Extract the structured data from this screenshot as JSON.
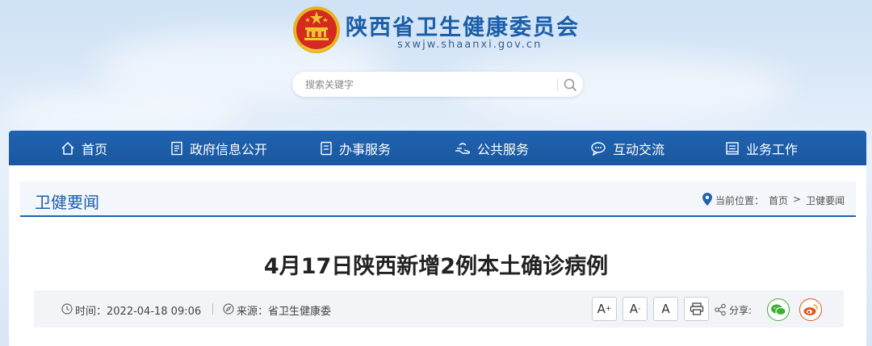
{
  "header": {
    "site_title": "陕西省卫生健康委员会",
    "site_domain": "sxwjw.shaanxi.gov.cn",
    "search_placeholder": "搜索关键字"
  },
  "nav": {
    "items": [
      {
        "label": "首页",
        "icon": "home-icon"
      },
      {
        "label": "政府信息公开",
        "icon": "document-icon"
      },
      {
        "label": "办事服务",
        "icon": "list-icon"
      },
      {
        "label": "公共服务",
        "icon": "hand-icon"
      },
      {
        "label": "互动交流",
        "icon": "chat-icon"
      },
      {
        "label": "业务工作",
        "icon": "folder-icon"
      }
    ]
  },
  "section": {
    "title": "卫健要闻",
    "location_prefix": "当前位置：",
    "breadcrumb_home": "首页",
    "breadcrumb_sep": ">",
    "breadcrumb_current": "卫健要闻"
  },
  "article": {
    "title": "4月17日陕西新增2例本土确诊病例",
    "time": "时间：2022-04-18 09:06",
    "source": "来源：省卫生健康委"
  },
  "tools": {
    "font_increase": "A",
    "font_decrease": "A",
    "font_reset": "A",
    "share_label": "分享:"
  },
  "colors": {
    "nav_blue": "#1f63b0",
    "title_blue": "#1b5ea8",
    "wechat_green": "#3cb034",
    "weibo_orange": "#e8541e"
  }
}
